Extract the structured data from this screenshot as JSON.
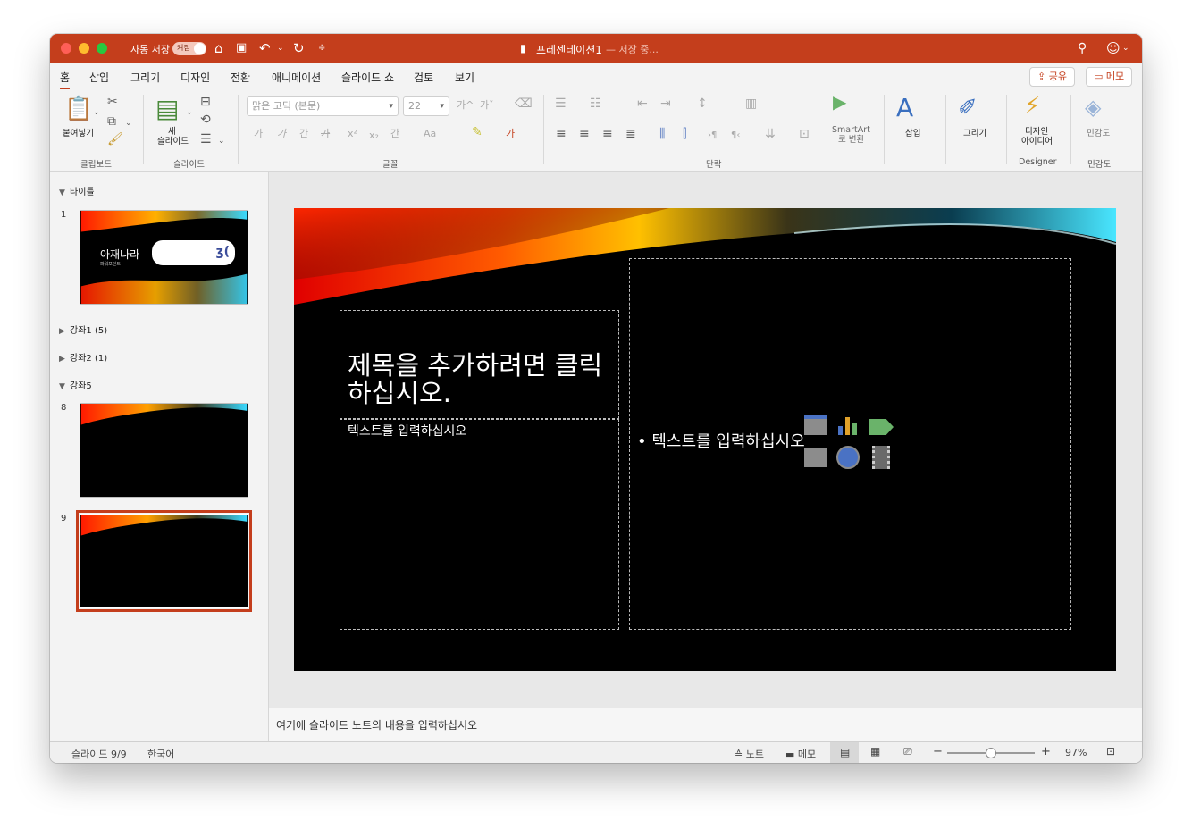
{
  "titlebar": {
    "autosave_label": "자동 저장",
    "autosave_state": "켜짐",
    "doc_title": "프레젠테이션1",
    "doc_status": "— 저장 중..."
  },
  "tabs": [
    {
      "label": "홈",
      "active": true
    },
    {
      "label": "삽입"
    },
    {
      "label": "그리기"
    },
    {
      "label": "디자인"
    },
    {
      "label": "전환"
    },
    {
      "label": "애니메이션"
    },
    {
      "label": "슬라이드 쇼"
    },
    {
      "label": "검토"
    },
    {
      "label": "보기"
    }
  ],
  "tab_actions": {
    "share": "공유",
    "comment": "메모"
  },
  "ribbon": {
    "paste": "붙여넣기",
    "new_slide_1": "새",
    "new_slide_2": "슬라이드",
    "font_name": "맑은 고딕 (본문)",
    "font_size": "22",
    "smartart_1": "SmartArt",
    "smartart_2": "로 변환",
    "insert": "삽입",
    "draw": "그리기",
    "designer_1": "디자인",
    "designer_2": "아이디어",
    "sensitivity": "민감도",
    "groups": {
      "clipboard": "클립보드",
      "slides": "슬라이드",
      "font": "글꼴",
      "paragraph": "단락",
      "designer": "Designer",
      "sensitivity": "민감도"
    },
    "font_glyphs": [
      "가",
      "가",
      "간",
      "가",
      "x²",
      "x₂",
      "간",
      "Aa",
      "가"
    ],
    "grow_shrink": [
      "가^",
      "가ˇ"
    ]
  },
  "panel": {
    "sections": [
      {
        "label": "타이틀",
        "expanded": true
      },
      {
        "label": "강좌1 (5)",
        "expanded": false
      },
      {
        "label": "강좌2 (1)",
        "expanded": false
      },
      {
        "label": "강좌5",
        "expanded": true
      }
    ],
    "slides": [
      {
        "num": "1",
        "title": "아재나라",
        "sub": "파워포인트"
      },
      {
        "num": "8"
      },
      {
        "num": "9",
        "selected": true
      }
    ]
  },
  "slide": {
    "title_placeholder": "제목을 추가하려면 클릭하십시오.",
    "text_placeholder": "텍스트를 입력하십시오",
    "content_placeholder": "• 텍스트를 입력하십시오"
  },
  "notes": {
    "placeholder": "여기에 슬라이드 노트의 내용을 입력하십시오"
  },
  "status": {
    "slide_info": "슬라이드 9/9",
    "language": "한국어",
    "notes": "노트",
    "comments": "메모",
    "zoom": "97%",
    "zoom_fraction": 0.5
  },
  "colors": {
    "accent": "#c43e1c"
  }
}
